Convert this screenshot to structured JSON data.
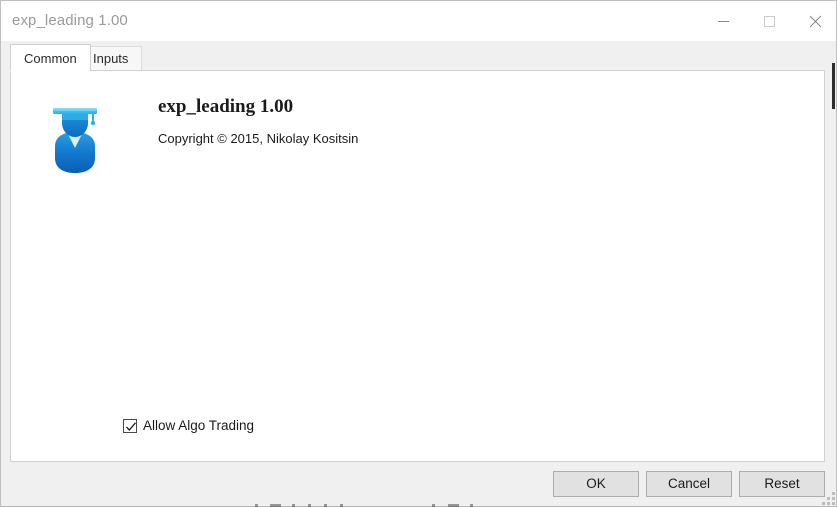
{
  "window": {
    "title": "exp_leading 1.00",
    "caption_buttons": [
      {
        "name": "minimize",
        "label": "Minimize",
        "icon": "minimize-icon"
      },
      {
        "name": "maximize",
        "label": "Maximize",
        "icon": "maximize-icon"
      },
      {
        "name": "close",
        "label": "Close",
        "icon": "close-icon"
      }
    ]
  },
  "tabs": [
    {
      "label": "Common",
      "active": true
    },
    {
      "label": "Inputs",
      "active": false
    }
  ],
  "about": {
    "icon": "graduate-logo-icon",
    "title": "exp_leading 1.00",
    "copyright": "Copyright © 2015, Nikolay Kositsin"
  },
  "options": {
    "allow_algo_trading": {
      "label": "Allow Algo Trading",
      "checked": true
    }
  },
  "footer": {
    "ok_label": "OK",
    "cancel_label": "Cancel",
    "reset_label": "Reset"
  },
  "colors": {
    "window_bg": "#f0f0f0",
    "panel_bg": "#ffffff",
    "title_text": "#9a9a9a",
    "body_text": "#1b1b1b",
    "button_bg": "#e1e1e1",
    "button_border": "#adadad",
    "logo_blue": "#0f6fc6",
    "logo_cyan": "#2bb6e8",
    "scroll_thumb": "#2d2d2d"
  }
}
